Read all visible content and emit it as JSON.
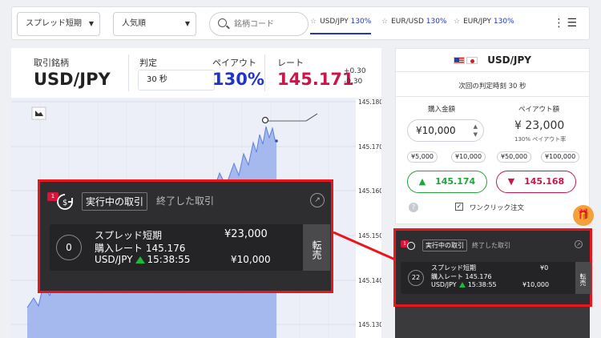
{
  "topbar": {
    "sort_type": "スプレッド短期",
    "sort_order": "人気順",
    "search_placeholder": "銘柄コード",
    "favorites": [
      {
        "pair": "USD/JPY",
        "payout": "130%"
      },
      {
        "pair": "EUR/USD",
        "payout": "130%"
      },
      {
        "pair": "EUR/JPY",
        "payout": "130%"
      }
    ]
  },
  "info": {
    "symbol_label": "取引銘柄",
    "symbol": "USD/JPY",
    "judge_label": "判定",
    "judge_value": "30 秒",
    "payout_label": "ペイアウト",
    "payout_value": "130%",
    "rate_label": "レート",
    "rate_value": "145.171",
    "rate_diff_up": "+0.30",
    "rate_diff_down": "-0.30"
  },
  "chart": {
    "yticks": [
      "145.180",
      "145.170",
      "145.160",
      "145.150",
      "145.140",
      "145.130"
    ],
    "colors": {
      "area": "#9db2ec",
      "line": "#5b7ee0"
    }
  },
  "order": {
    "pair": "USD/JPY",
    "next_judge": "次回の判定時刻 30 秒",
    "amount_label": "購入金額",
    "payout_amount_label": "ペイアウト額",
    "amount": "¥10,000",
    "payout_amount": "¥ 23,000",
    "payout_rate": "130% ペイアウト率",
    "chips": [
      "¥5,000",
      "¥10,000",
      "¥50,000",
      "¥100,000"
    ],
    "high_rate": "145.174",
    "low_rate": "145.168",
    "one_click": "ワンクリック注文",
    "help": "?"
  },
  "trades": {
    "badge_count": "1",
    "tab_active": "実行中の取引",
    "tab_done": "終了した取引",
    "sell_label": "転売",
    "zoom_card": {
      "counter": "0",
      "type": "スプレッド短期",
      "purchase_rate": "購入レート 145.176",
      "pair": "USD/JPY",
      "time": "15:38:55",
      "payout": "¥23,000",
      "amount": "¥10,000"
    },
    "small_card": {
      "counter": "22",
      "type": "スプレッド短期",
      "purchase_rate": "購入レート 145.176",
      "pair": "USD/JPY",
      "time": "15:38:55",
      "payout": "¥0",
      "amount": "¥10,000"
    }
  }
}
